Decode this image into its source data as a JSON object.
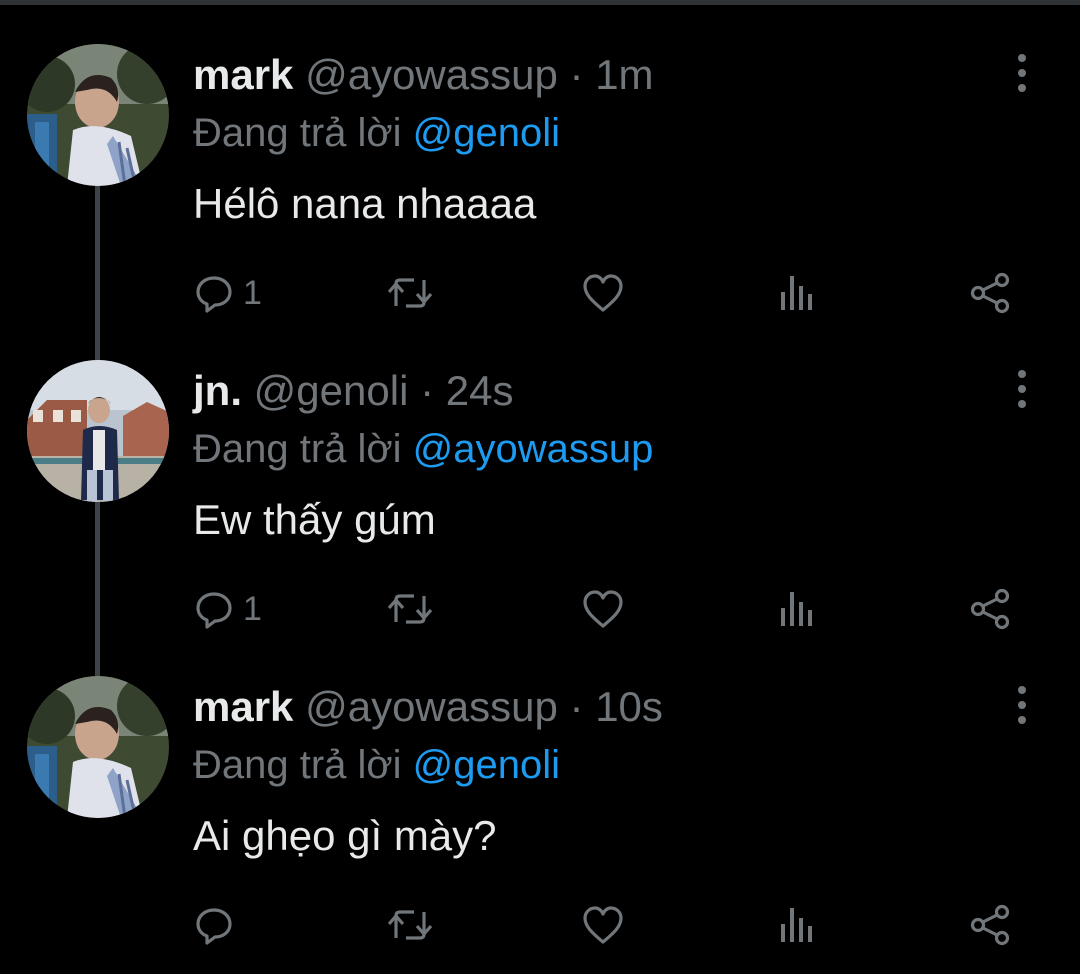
{
  "colors": {
    "background": "#000000",
    "text_primary": "#e7e9ea",
    "text_secondary": "#71767b",
    "mention_blue": "#1d9bf0",
    "thread_line": "#3d4348"
  },
  "tweets": [
    {
      "name": "mark",
      "handle": "@ayowassup",
      "separator": "·",
      "time": "1m",
      "reply_prefix": "Đang trả lời ",
      "reply_mention": "@genoli",
      "text": "Hélô nana nhaaaa",
      "reply_count": "1",
      "avatar": "avatar-mark"
    },
    {
      "name": "jn.",
      "handle": "@genoli",
      "separator": "·",
      "time": "24s",
      "reply_prefix": "Đang trả lời ",
      "reply_mention": "@ayowassup",
      "text": "Ew thấy gúm",
      "reply_count": "1",
      "avatar": "avatar-jn"
    },
    {
      "name": "mark",
      "handle": "@ayowassup",
      "separator": "·",
      "time": "10s",
      "reply_prefix": "Đang trả lời ",
      "reply_mention": "@genoli",
      "text": "Ai ghẹo gì mày?",
      "reply_count": "",
      "avatar": "avatar-mark"
    }
  ],
  "icons": {
    "reply": "reply-icon",
    "retweet": "retweet-icon",
    "like": "heart-icon",
    "views": "analytics-icon",
    "share": "share-icon",
    "more": "more-vertical-icon"
  }
}
